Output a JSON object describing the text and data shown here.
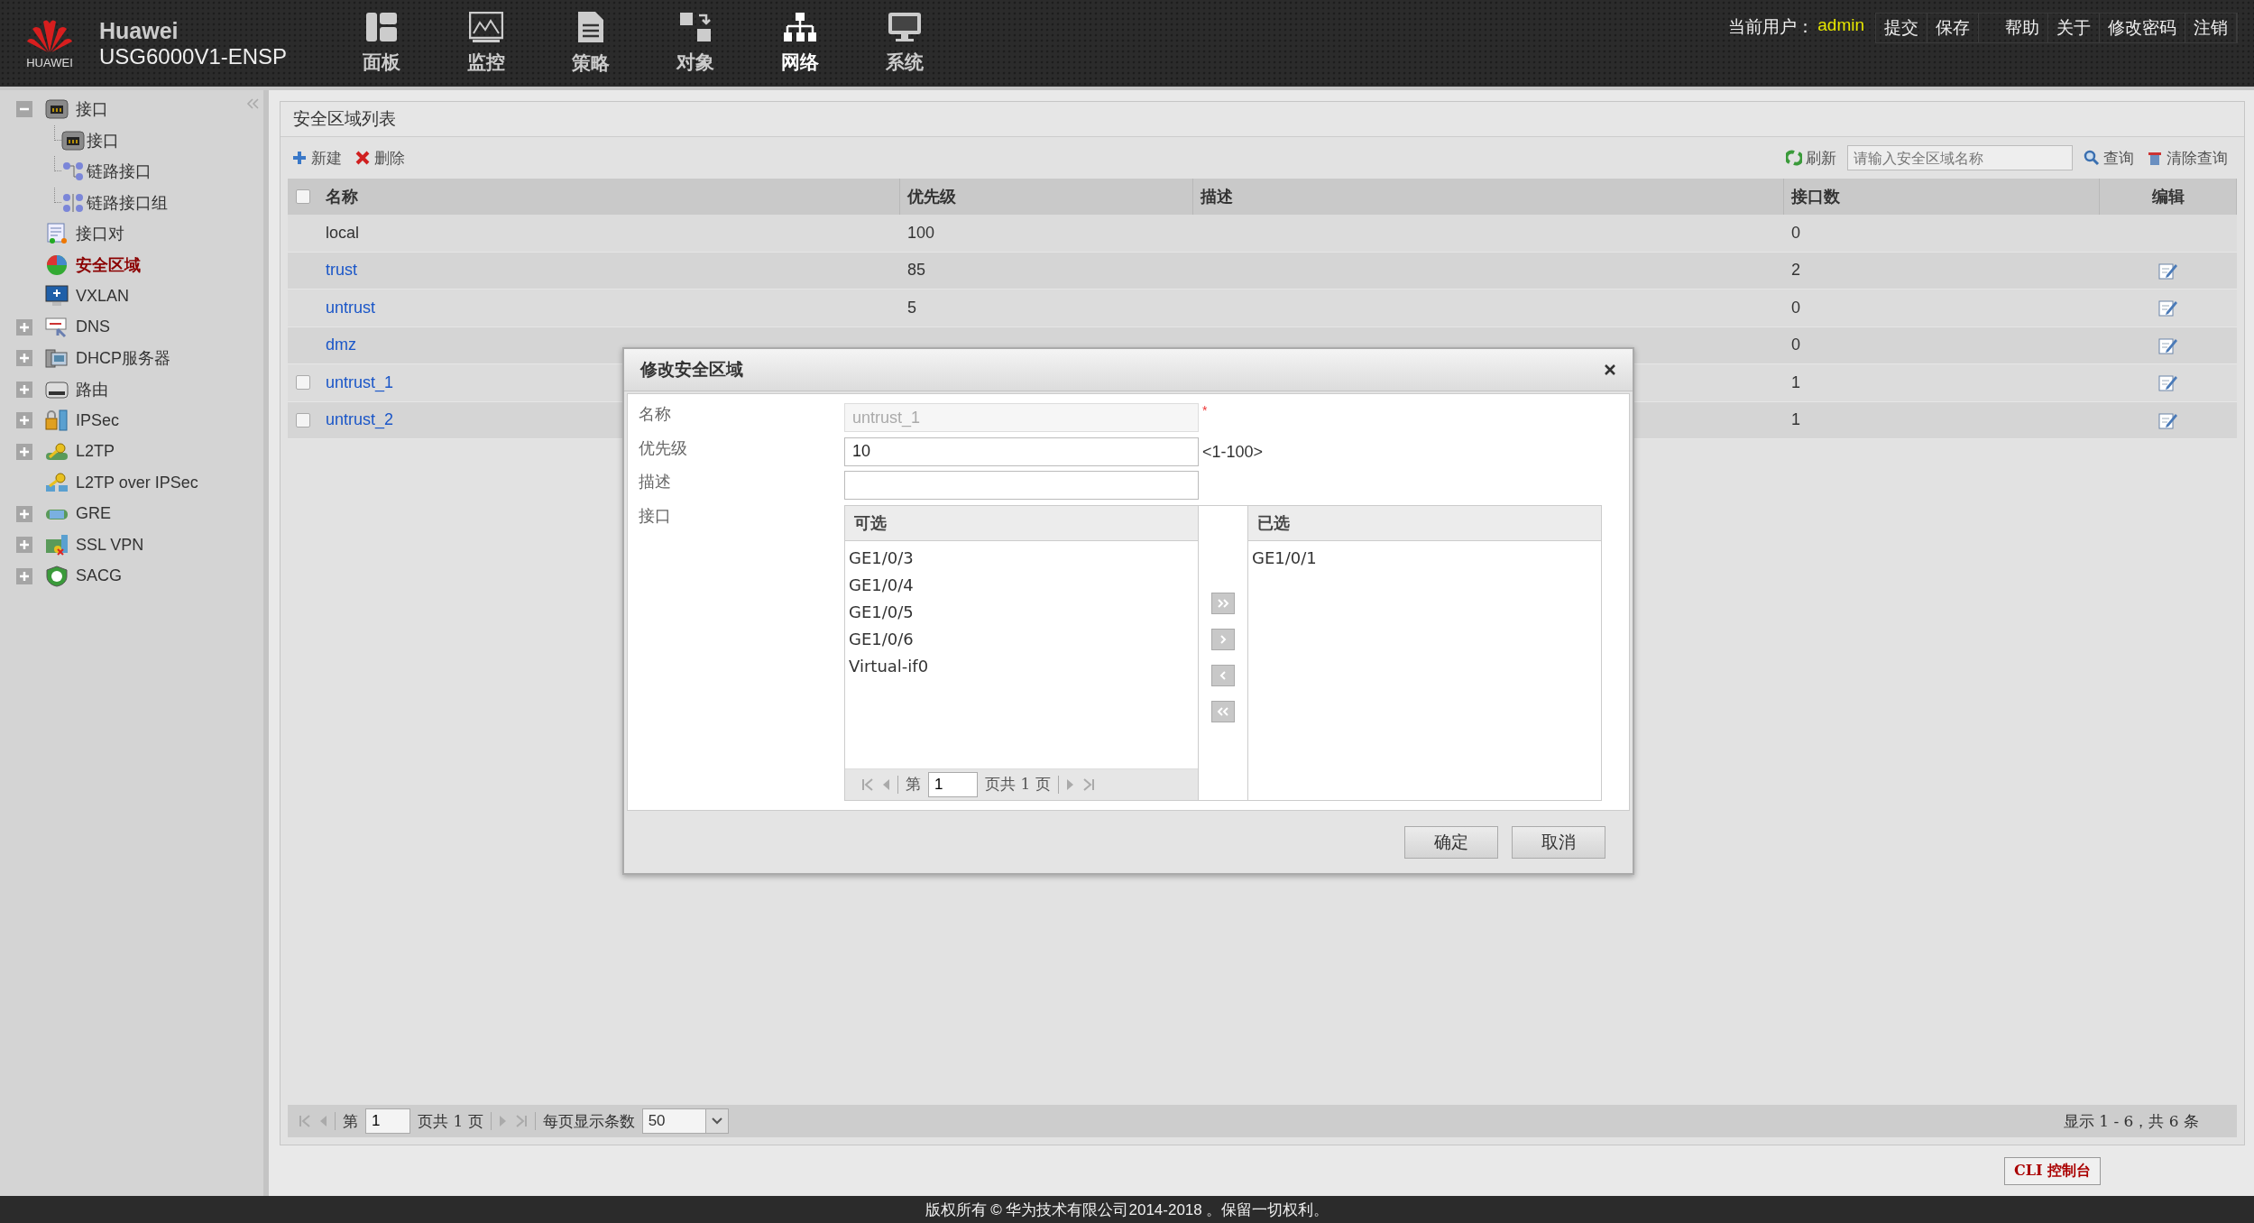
{
  "header": {
    "logo_text": "HUAWEI",
    "brand": "Huawei",
    "model": "USG6000V1-ENSP",
    "nav": [
      {
        "label": "面板",
        "selected": false
      },
      {
        "label": "监控",
        "selected": false
      },
      {
        "label": "策略",
        "selected": false
      },
      {
        "label": "对象",
        "selected": false
      },
      {
        "label": "网络",
        "selected": true
      },
      {
        "label": "系统",
        "selected": false
      }
    ],
    "user_label": "当前用户：",
    "user": "admin",
    "links": [
      "提交",
      "保存",
      "帮助",
      "关于",
      "修改密码",
      "注销"
    ]
  },
  "sidebar": {
    "items": [
      {
        "label": "接口",
        "kind": "group",
        "expanded": true,
        "selected": false,
        "children": [
          {
            "label": "接口",
            "selected": false
          },
          {
            "label": "链路接口",
            "selected": false
          },
          {
            "label": "链路接口组",
            "selected": false
          }
        ]
      },
      {
        "label": "接口对",
        "kind": "leaf",
        "selected": false
      },
      {
        "label": "安全区域",
        "kind": "leaf",
        "selected": true
      },
      {
        "label": "VXLAN",
        "kind": "leaf",
        "selected": false
      },
      {
        "label": "DNS",
        "kind": "group",
        "expanded": false,
        "selected": false
      },
      {
        "label": "DHCP服务器",
        "kind": "group",
        "expanded": false,
        "selected": false
      },
      {
        "label": "路由",
        "kind": "group",
        "expanded": false,
        "selected": false
      },
      {
        "label": "IPSec",
        "kind": "group",
        "expanded": false,
        "selected": false
      },
      {
        "label": "L2TP",
        "kind": "group",
        "expanded": false,
        "selected": false
      },
      {
        "label": "L2TP over IPSec",
        "kind": "leaf",
        "selected": false
      },
      {
        "label": "GRE",
        "kind": "group",
        "expanded": false,
        "selected": false
      },
      {
        "label": "SSL VPN",
        "kind": "group",
        "expanded": false,
        "selected": false
      },
      {
        "label": "SACG",
        "kind": "group",
        "expanded": false,
        "selected": false
      }
    ]
  },
  "panel": {
    "title": "安全区域列表",
    "toolbar": {
      "new": "新建",
      "delete": "删除",
      "refresh": "刷新",
      "search_placeholder": "请输入安全区域名称",
      "query": "查询",
      "clear": "清除查询"
    },
    "table": {
      "columns": [
        "名称",
        "优先级",
        "描述",
        "接口数",
        "编辑"
      ],
      "all_checked": false,
      "rows": [
        {
          "name": "local",
          "kind": "builtin",
          "editable": false,
          "priority": "100",
          "interfaces": "0"
        },
        {
          "name": "trust",
          "kind": "builtin",
          "editable": true,
          "priority": "85",
          "interfaces": "2"
        },
        {
          "name": "untrust",
          "kind": "builtin",
          "editable": true,
          "priority": "5",
          "interfaces": "0"
        },
        {
          "name": "dmz",
          "kind": "builtin",
          "editable": true,
          "interfaces": "0"
        },
        {
          "name": "untrust_1",
          "kind": "user",
          "checked": false,
          "editable": true,
          "interfaces": "1"
        },
        {
          "name": "untrust_2",
          "kind": "user",
          "checked": false,
          "editable": true,
          "interfaces": "1"
        }
      ]
    },
    "pager": {
      "page_before": "第",
      "page": "1",
      "page_after": "页共 1 页",
      "per_page_label": "每页显示条数",
      "per_page": "50",
      "summary": "显示 1 - 6，共 6 条"
    }
  },
  "cli_button": "CLI 控制台",
  "footer": "版权所有 © 华为技术有限公司2014-2018 。保留一切权利。",
  "dialog": {
    "title": "修改安全区域",
    "fields": [
      {
        "label": "名称",
        "value": "untrust_1",
        "disabled": true,
        "mark": "*"
      },
      {
        "label": "优先级",
        "value": "10",
        "disabled": false,
        "hint": "<1-100>"
      },
      {
        "label": "描述",
        "disabled": false
      }
    ],
    "interface_label": "接口",
    "available": {
      "title": "可选",
      "items": [
        "GE1/0/3",
        "GE1/0/4",
        "GE1/0/5",
        "GE1/0/6",
        "Virtual-if0"
      ],
      "pager": {
        "page_before": "第",
        "page": "1",
        "page_after": "页共 1 页"
      }
    },
    "chosen": {
      "title": "已选",
      "items": [
        "GE1/0/1"
      ]
    },
    "buttons": [
      "确定",
      "取消"
    ]
  }
}
